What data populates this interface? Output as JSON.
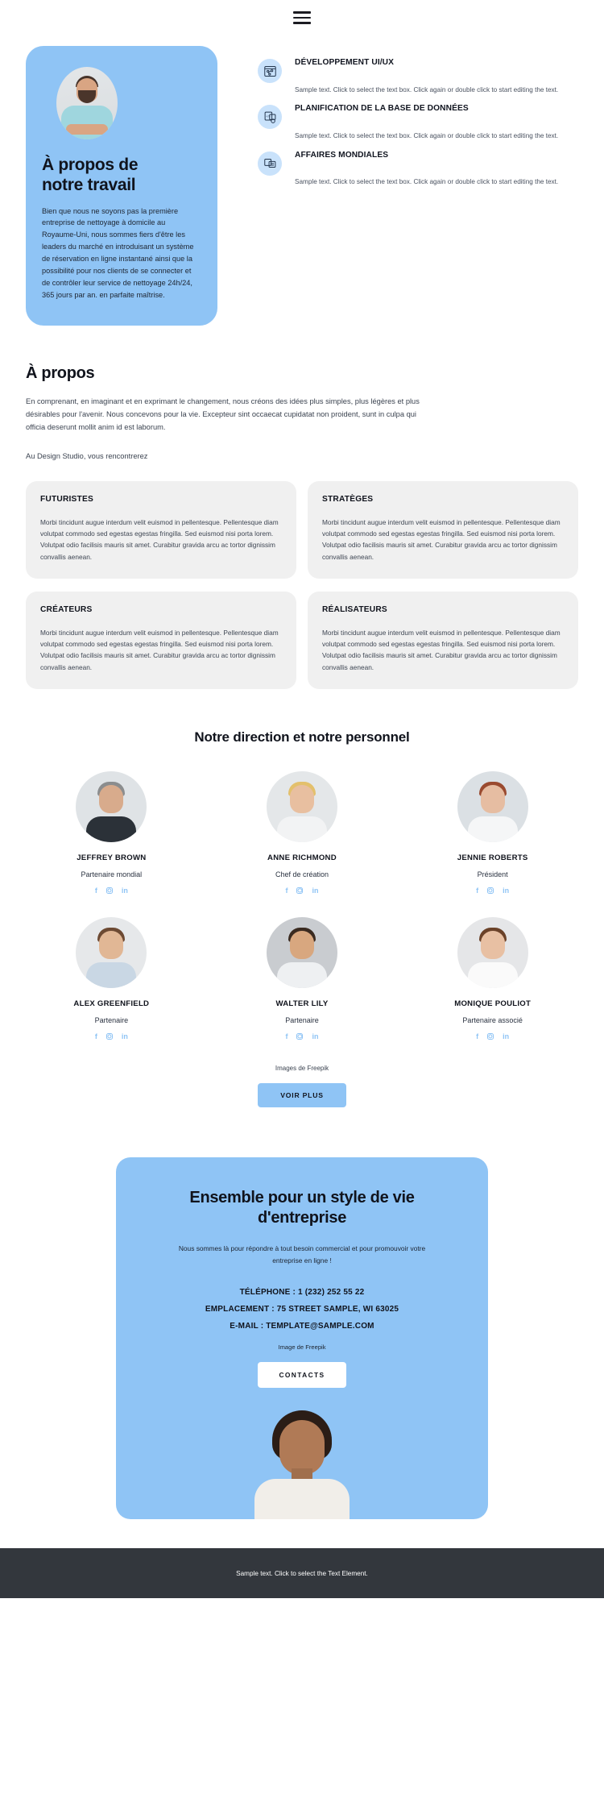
{
  "header": {
    "menu_icon": "hamburger-menu-icon"
  },
  "hero": {
    "title": "À propos de\nnotre travail",
    "title_line1": "À propos de",
    "title_line2": "notre travail",
    "text": "Bien que nous ne soyons pas la première entreprise de nettoyage à domicile au Royaume-Uni, nous sommes fiers d'être les leaders du marché en introduisant un système de réservation en ligne instantané ainsi que la possibilité pour nos clients de se connecter et de contrôler leur service de nettoyage 24h/24, 365 jours par an. en parfaite maîtrise.",
    "services": [
      {
        "icon": "wireframe-layout-icon",
        "title": "DÉVELOPPEMENT UI/UX",
        "desc": "Sample text. Click to select the text box. Click again or double click to start editing the text."
      },
      {
        "icon": "database-code-icon",
        "title": "PLANIFICATION DE LA BASE DE DONNÉES",
        "desc": "Sample text. Click to select the text box. Click again or double click to start editing the text."
      },
      {
        "icon": "global-business-icon",
        "title": "AFFAIRES MONDIALES",
        "desc": "Sample text. Click to select the text box. Click again or double click to start editing the text."
      }
    ]
  },
  "about": {
    "heading": "À propos",
    "paragraph": "En comprenant, en imaginant et en exprimant le changement, nous créons des idées plus simples, plus légères et plus désirables pour l'avenir. Nous concevons pour la vie. Excepteur sint occaecat cupidatat non proident, sunt in culpa qui officia deserunt mollit anim id est laborum.",
    "subline": "Au Design Studio, vous rencontrerez",
    "cards": [
      {
        "title": "FUTURISTES",
        "body": "Morbi tincidunt augue interdum velit euismod in pellentesque. Pellentesque diam volutpat commodo sed egestas egestas fringilla. Sed euismod nisi porta lorem. Volutpat odio facilisis mauris sit amet. Curabitur gravida arcu ac tortor dignissim convallis aenean."
      },
      {
        "title": "STRATÈGES",
        "body": "Morbi tincidunt augue interdum velit euismod in pellentesque. Pellentesque diam volutpat commodo sed egestas egestas fringilla. Sed euismod nisi porta lorem. Volutpat odio facilisis mauris sit amet. Curabitur gravida arcu ac tortor dignissim convallis aenean."
      },
      {
        "title": "CRÉATEURS",
        "body": "Morbi tincidunt augue interdum velit euismod in pellentesque. Pellentesque diam volutpat commodo sed egestas egestas fringilla. Sed euismod nisi porta lorem. Volutpat odio facilisis mauris sit amet. Curabitur gravida arcu ac tortor dignissim convallis aenean."
      },
      {
        "title": "RÉALISATEURS",
        "body": "Morbi tincidunt augue interdum velit euismod in pellentesque. Pellentesque diam volutpat commodo sed egestas egestas fringilla. Sed euismod nisi porta lorem. Volutpat odio facilisis mauris sit amet. Curabitur gravida arcu ac tortor dignissim convallis aenean."
      }
    ]
  },
  "team": {
    "heading": "Notre direction et notre personnel",
    "members": [
      {
        "name": "JEFFREY BROWN",
        "role": "Partenaire mondial",
        "colors": {
          "bg": "#dfe3e6",
          "hair": "#8b8d8e",
          "skin": "#d8ab8c",
          "body": "#2b3138"
        }
      },
      {
        "name": "ANNE RICHMOND",
        "role": "Chef de création",
        "colors": {
          "bg": "#e4e7e9",
          "hair": "#e3c06c",
          "skin": "#e8bfa0",
          "body": "#f2f3f4"
        }
      },
      {
        "name": "JENNIE ROBERTS",
        "role": "Président",
        "colors": {
          "bg": "#dbe0e4",
          "hair": "#9a4a2f",
          "skin": "#e6bda2",
          "body": "#f5f6f7"
        }
      },
      {
        "name": "ALEX GREENFIELD",
        "role": "Partenaire",
        "colors": {
          "bg": "#e6e8ea",
          "hair": "#6d4a33",
          "skin": "#e1b795",
          "body": "#c9d7e4"
        }
      },
      {
        "name": "WALTER LILY",
        "role": "Partenaire",
        "colors": {
          "bg": "#c9ccd0",
          "hair": "#3a2a20",
          "skin": "#d8a77f",
          "body": "#eef0f2"
        }
      },
      {
        "name": "MONIQUE POULIOT",
        "role": "Partenaire associé",
        "colors": {
          "bg": "#e5e6e8",
          "hair": "#6b4229",
          "skin": "#e8c0a3",
          "body": "#fafafa"
        }
      }
    ],
    "socials": [
      "facebook-icon",
      "instagram-icon",
      "linkedin-icon"
    ],
    "social_labels": {
      "facebook": "f",
      "linkedin": "in"
    },
    "credit": "Images de Freepik",
    "more_button": "VOIR PLUS"
  },
  "contact": {
    "heading_line1": "Ensemble pour un style de vie",
    "heading_line2": "d'entreprise",
    "subtitle": "Nous sommes là pour répondre à tout besoin commercial et pour promouvoir votre entreprise en ligne !",
    "phone": "TÉLÉPHONE : 1 (232) 252 55 22",
    "location": "EMPLACEMENT : 75 STREET SAMPLE, WI 63025",
    "email": "E-MAIL : TEMPLATE@SAMPLE.COM",
    "image_credit": "Image de Freepik",
    "button": "CONTACTS"
  },
  "footer": {
    "text": "Sample text. Click to select the Text Element."
  },
  "colors": {
    "accent": "#8fc4f5",
    "icon_bg": "#c9e2fb",
    "card_bg": "#f0f0f0",
    "footer_bg": "#33373d",
    "text_dark": "#10131c"
  }
}
